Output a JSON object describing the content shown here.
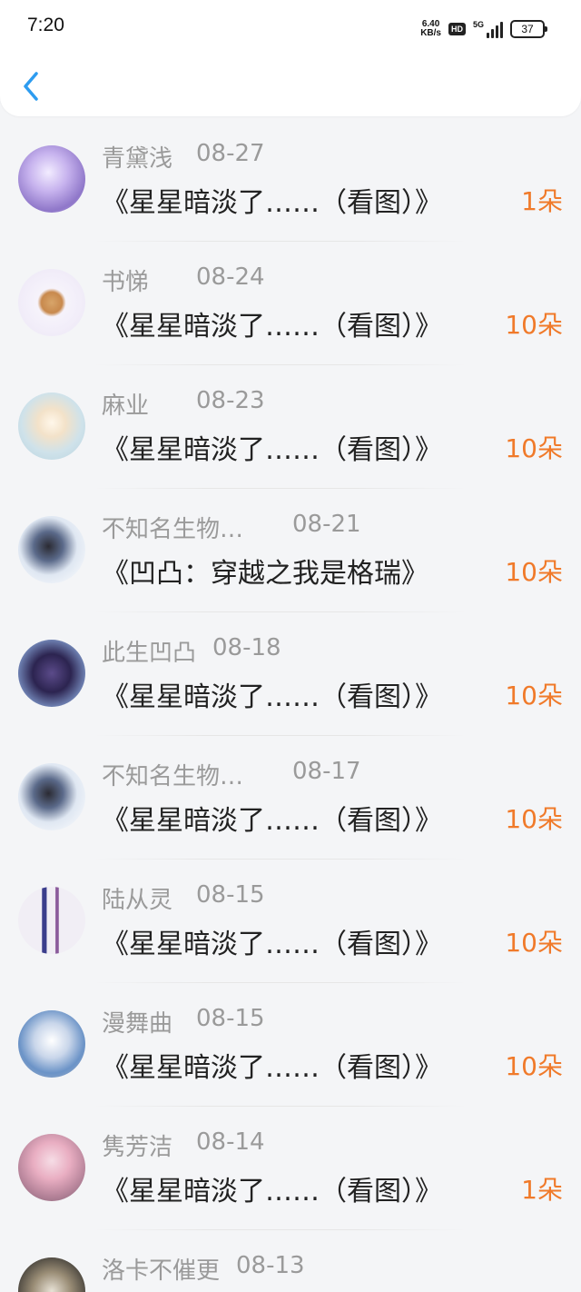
{
  "status_bar": {
    "time": "7:20",
    "net_speed_value": "6.40",
    "net_speed_unit": "KB/s",
    "hd_label": "HD",
    "network_label": "5G",
    "battery_level": "37"
  },
  "header": {
    "back_icon": "chevron-left-icon",
    "accent_color": "#2d9cf0"
  },
  "colors": {
    "count": "#f07a2a",
    "meta": "#9a9a9a",
    "title": "#222222"
  },
  "items": [
    {
      "name": "青黛浅",
      "date": "08-27",
      "title": "《星星暗淡了……（看图）》",
      "count": "1朵"
    },
    {
      "name": "书悌",
      "date": "08-24",
      "title": "《星星暗淡了……（看图）》",
      "count": "10朵"
    },
    {
      "name": "麻业",
      "date": "08-23",
      "title": "《星星暗淡了……（看图）》",
      "count": "10朵"
    },
    {
      "name": "不知名生物…",
      "date": "08-21",
      "title": "《凹凸：穿越之我是格瑞》",
      "count": "10朵"
    },
    {
      "name": "此生凹凸",
      "date": "08-18",
      "title": "《星星暗淡了……（看图）》",
      "count": "10朵"
    },
    {
      "name": "不知名生物…",
      "date": "08-17",
      "title": "《星星暗淡了……（看图）》",
      "count": "10朵"
    },
    {
      "name": "陆从灵",
      "date": "08-15",
      "title": "《星星暗淡了……（看图）》",
      "count": "10朵"
    },
    {
      "name": "漫舞曲",
      "date": "08-15",
      "title": "《星星暗淡了……（看图）》",
      "count": "10朵"
    },
    {
      "name": "隽芳洁",
      "date": "08-14",
      "title": "《星星暗淡了……（看图）》",
      "count": "1朵"
    },
    {
      "name": "洛卡不催更",
      "date": "08-13",
      "title": "",
      "count": ""
    }
  ]
}
